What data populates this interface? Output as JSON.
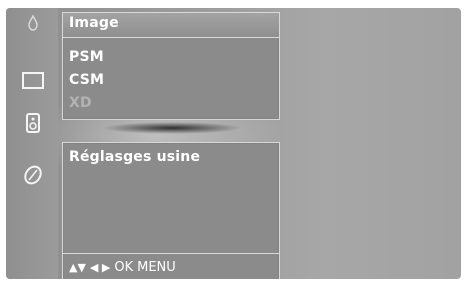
{
  "menu": {
    "title": "Image",
    "items": [
      {
        "label": "PSM",
        "enabled": true
      },
      {
        "label": "CSM",
        "enabled": true
      },
      {
        "label": "XD",
        "enabled": false
      }
    ]
  },
  "submenu": {
    "label": "Réglasges usine"
  },
  "navigation": {
    "up_down": "▲▼",
    "left_right": "◀ ▶",
    "ok": "OK",
    "menu": "MENU"
  },
  "icons": [
    "picture-icon",
    "screen-icon",
    "sound-icon",
    "option-icon"
  ],
  "colors": {
    "panel_background": "#8b8b8b",
    "screen_background": "#9d9d9d",
    "text": "#ffffff"
  }
}
